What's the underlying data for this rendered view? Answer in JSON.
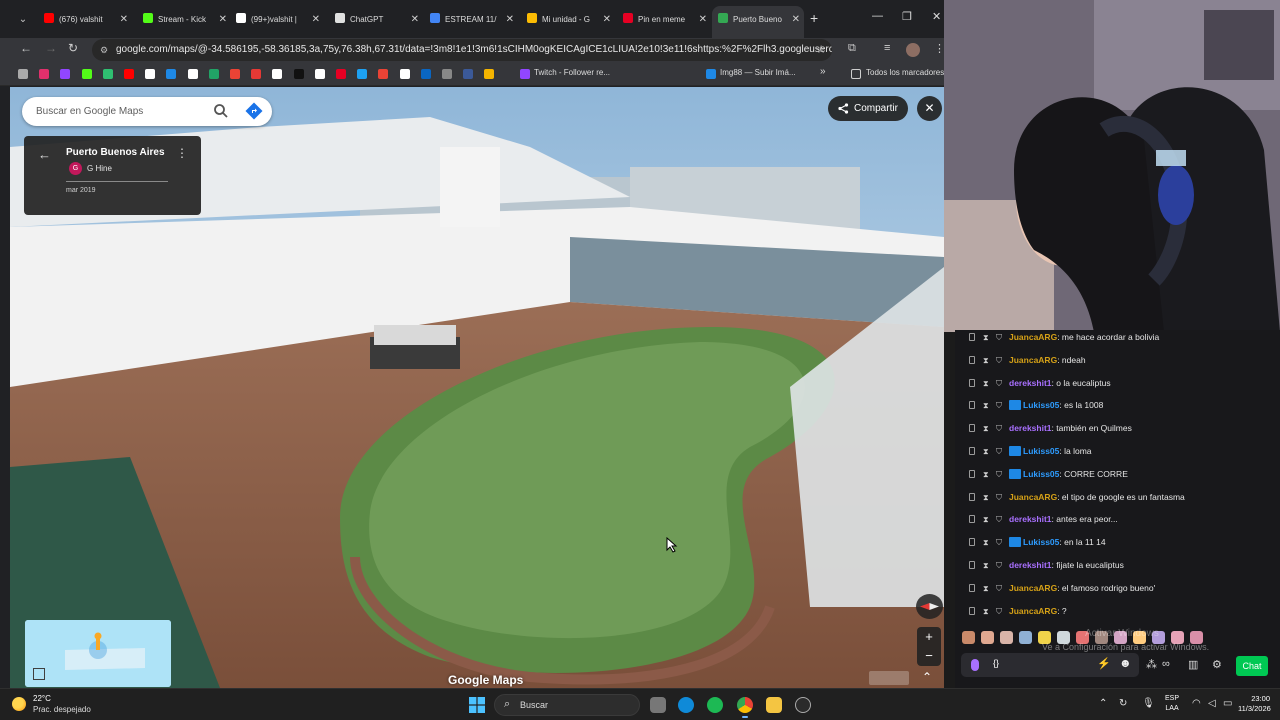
{
  "browser": {
    "tabs": [
      {
        "label": "(676) valshit",
        "icon": "youtube-icon",
        "color": "#ff0000"
      },
      {
        "label": "Stream - Kick",
        "icon": "kick-icon",
        "color": "#53fc18"
      },
      {
        "label": "(99+)valshit |",
        "icon": "tiktok-icon",
        "color": "#ffffff"
      },
      {
        "label": "ChatGPT",
        "icon": "chatgpt-icon",
        "color": "#e0e0e0"
      },
      {
        "label": "ESTREAM 11/",
        "icon": "sheets-icon",
        "color": "#4285f4"
      },
      {
        "label": "Mi unidad - G",
        "icon": "drive-icon",
        "color": "#fbbc04"
      },
      {
        "label": "Pin en meme",
        "icon": "pinterest-icon",
        "color": "#e60023"
      },
      {
        "label": "Puerto Bueno",
        "icon": "maps-pin-icon",
        "color": "#34a853"
      }
    ],
    "url": "google.com/maps/@-34.586195,-58.36185,3a,75y,76.38h,67.31t/data=!3m8!1e1!3m6!1sCIHM0ogKEICAgICE1cLIUA!2e10!3e11!6shttps:%2F%2Flh3.googleuserconten...",
    "bookmarks_tail": [
      "Twitch - Follower re...",
      "Img88 — Subir Imá..."
    ],
    "bookmarks_folder": "Todos los marcadores"
  },
  "maps": {
    "search_placeholder": "Buscar en Google Maps",
    "place_title": "Puerto Buenos Aires",
    "author_initial": "G",
    "author_name": "G Hine",
    "capture_date": "mar 2019",
    "share_label": "Compartir",
    "watermark": "Google Maps"
  },
  "chat": {
    "messages": [
      {
        "user": "JuancaARG",
        "text": ": me hace acordar a bolivia",
        "color": "#d4a017",
        "badge": false
      },
      {
        "user": "JuancaARG",
        "text": ": ndeah",
        "color": "#d4a017",
        "badge": false
      },
      {
        "user": "derekshit1",
        "text": ": o la eucaliptus",
        "color": "#a970ff",
        "badge": false
      },
      {
        "user": "Lukiss05",
        "text": ": es la 1008",
        "color": "#2e9cff",
        "badge": true
      },
      {
        "user": "derekshit1",
        "text": ": también en Quilmes",
        "color": "#a970ff",
        "badge": false
      },
      {
        "user": "Lukiss05",
        "text": ": la loma",
        "color": "#2e9cff",
        "badge": true
      },
      {
        "user": "Lukiss05",
        "text": ": CORRE CORRE",
        "color": "#2e9cff",
        "badge": true
      },
      {
        "user": "JuancaARG",
        "text": ": el tipo de google es un fantasma",
        "color": "#d4a017",
        "badge": false
      },
      {
        "user": "derekshit1",
        "text": ": antes era peor...",
        "color": "#a970ff",
        "badge": false
      },
      {
        "user": "Lukiss05",
        "text": ": en la 11 14",
        "color": "#2e9cff",
        "badge": true
      },
      {
        "user": "derekshit1",
        "text": ": fijate la eucaliptus",
        "color": "#a970ff",
        "badge": false
      },
      {
        "user": "JuancaARG",
        "text": ": el famoso rodrigo bueno'",
        "color": "#d4a017",
        "badge": false
      },
      {
        "user": "JuancaARG",
        "text": ": ?",
        "color": "#d4a017",
        "badge": false
      }
    ],
    "input_value": "{}",
    "send_label": "Chat",
    "activation_title": "Activar Windows",
    "activation_text": "Ve a Configuración para activar Windows."
  },
  "taskbar": {
    "weather_temp": "22°C",
    "weather_desc": "Prac. despejado",
    "search_label": "Buscar",
    "lang_line1": "ESP",
    "lang_line2": "LAA",
    "time": "23:00",
    "date": "11/3/2026"
  }
}
